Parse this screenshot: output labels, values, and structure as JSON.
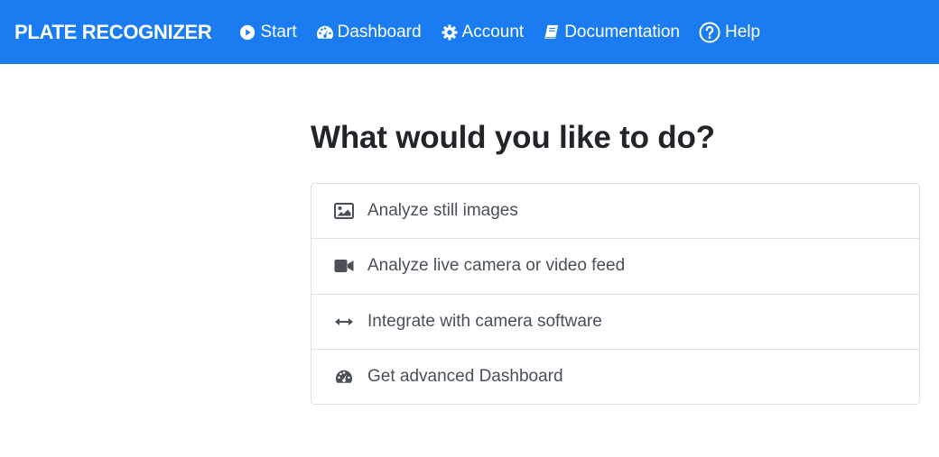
{
  "navbar": {
    "brand": "PLATE RECOGNIZER",
    "items": [
      {
        "label": "Start",
        "icon": "play-circle-icon"
      },
      {
        "label": "Dashboard",
        "icon": "tachometer-icon"
      },
      {
        "label": "Account",
        "icon": "gear-icon"
      },
      {
        "label": "Documentation",
        "icon": "book-icon"
      },
      {
        "label": "Help",
        "icon": "question-circle-icon"
      }
    ],
    "colors": {
      "background": "#1a7cf0",
      "text": "#ffffff"
    }
  },
  "main": {
    "heading": "What would you like to do?",
    "options": [
      {
        "label": "Analyze still images",
        "icon": "image-icon"
      },
      {
        "label": "Analyze live camera or video feed",
        "icon": "video-camera-icon"
      },
      {
        "label": "Integrate with camera software",
        "icon": "arrows-horizontal-icon"
      },
      {
        "label": "Get advanced Dashboard",
        "icon": "tachometer-icon"
      }
    ]
  }
}
